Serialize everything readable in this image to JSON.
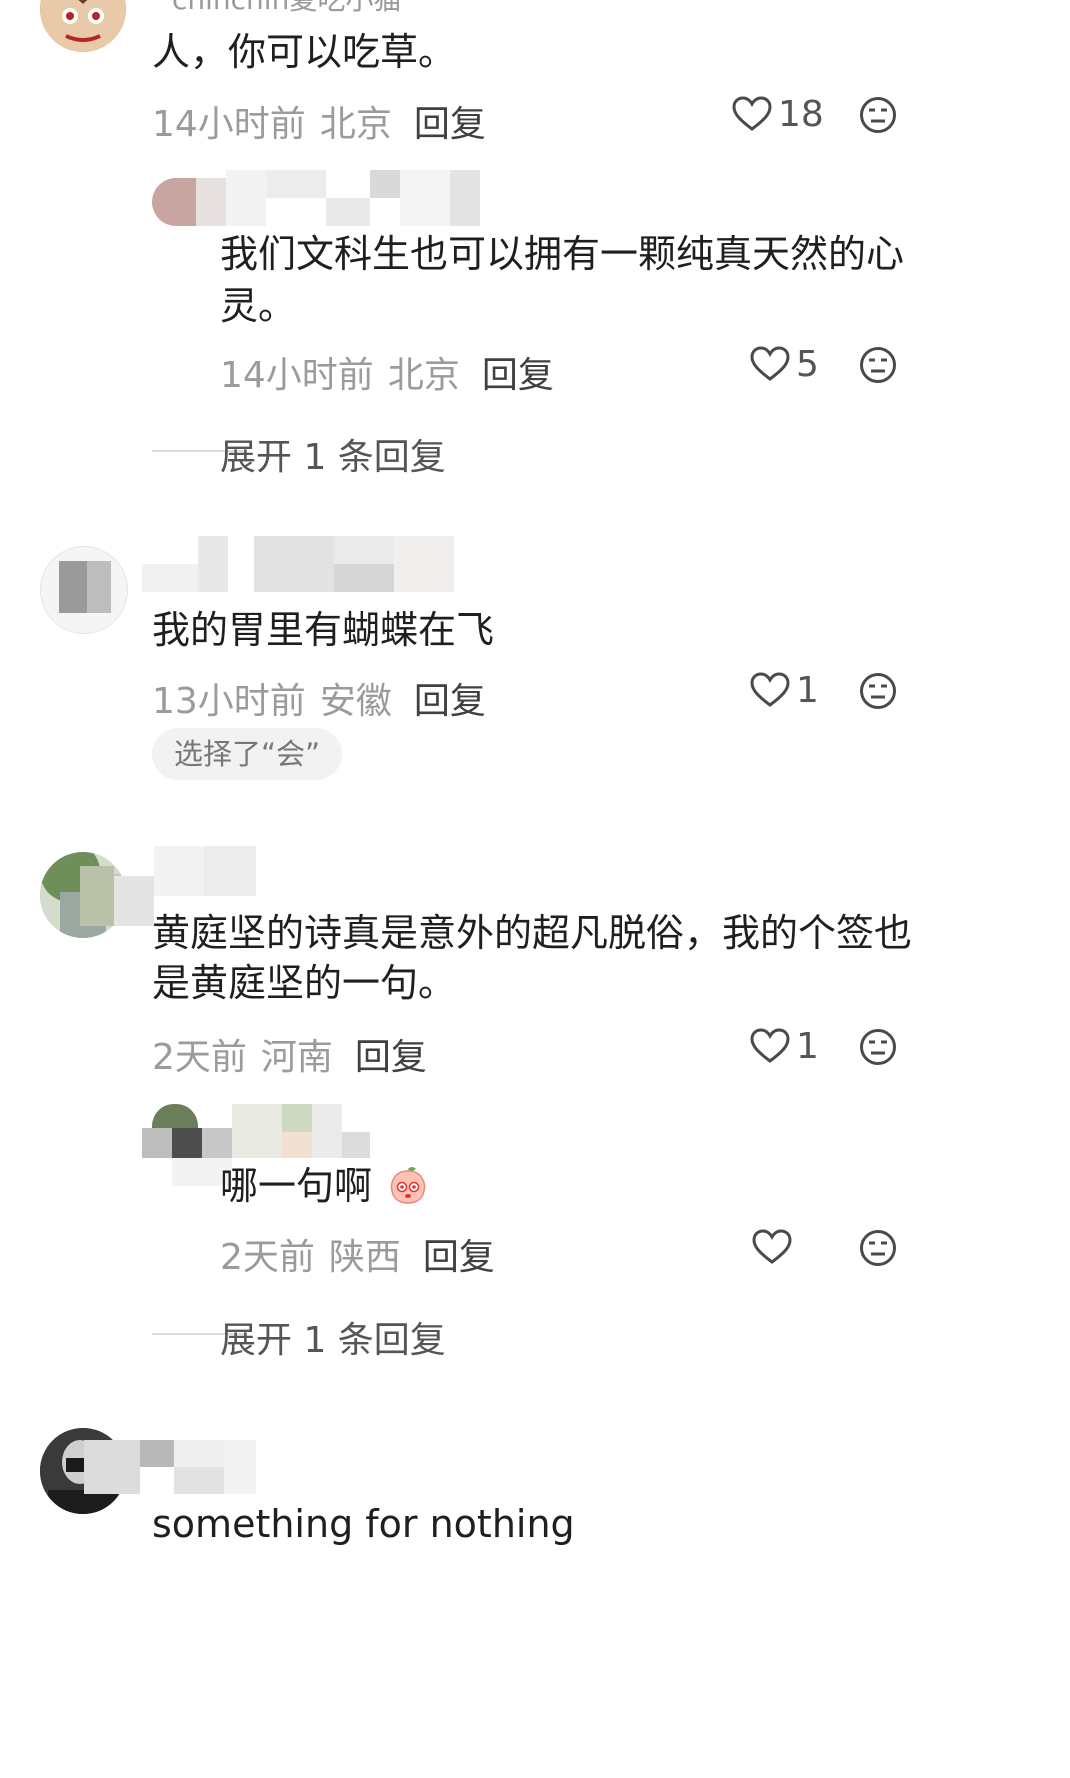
{
  "comments": [
    {
      "username_partial": "chinchin夏吃小猫",
      "text": "人，你可以吃草。",
      "time": "14小时前",
      "location": "北京",
      "reply_label": "回复",
      "likes": "18",
      "replies": [
        {
          "text": "我们文科生也可以拥有一颗纯真天然的心灵。",
          "time": "14小时前",
          "location": "北京",
          "reply_label": "回复",
          "likes": "5"
        }
      ],
      "expand_label": "展开 1 条回复"
    },
    {
      "text": "我的胃里有蝴蝶在飞",
      "time": "13小时前",
      "location": "安徽",
      "reply_label": "回复",
      "likes": "1",
      "chip": "选择了“会”"
    },
    {
      "text": "黄庭坚的诗真是意外的超凡脱俗，我的个签也是黄庭坚的一句。",
      "time": "2天前",
      "location": "河南",
      "reply_label": "回复",
      "likes": "1",
      "replies": [
        {
          "text": "哪一句啊",
          "time": "2天前",
          "location": "陕西",
          "reply_label": "回复",
          "likes": ""
        }
      ],
      "expand_label": "展开 1 条回复"
    },
    {
      "text": "something for nothing"
    }
  ],
  "icons": {
    "like": "heart-outline-icon",
    "dislike": "meh-face-icon",
    "emoji": "peach-emoji-icon"
  },
  "colors": {
    "text": "#1f1f1f",
    "meta": "#9b9b9b",
    "icon": "#4a4a4a"
  }
}
